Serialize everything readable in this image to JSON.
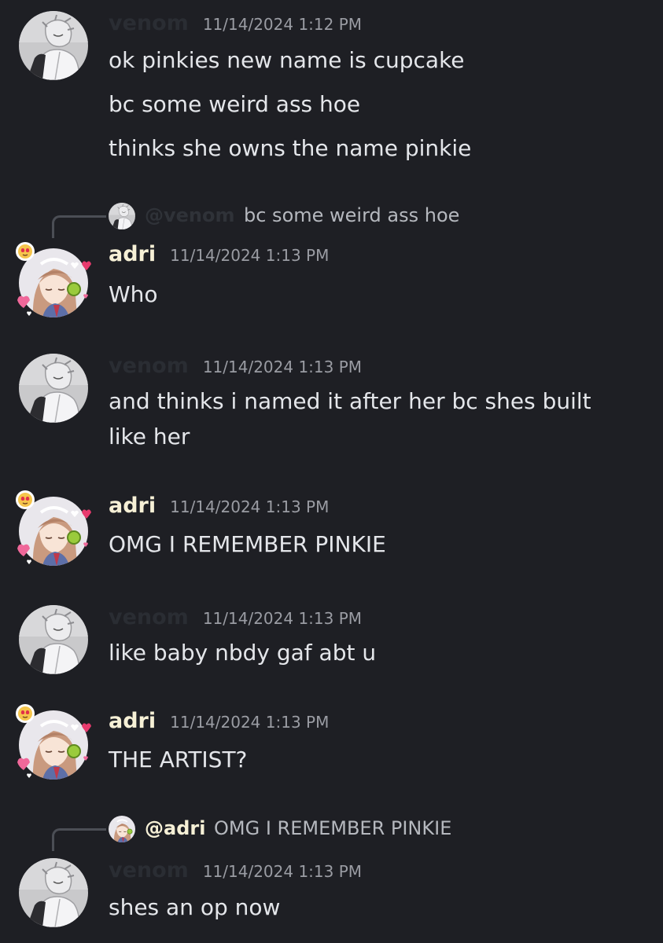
{
  "users": {
    "venom": {
      "name": "venom"
    },
    "adri": {
      "name": "adri"
    }
  },
  "messages": [
    {
      "author": "venom",
      "timestamp": "11/14/2024 1:12 PM",
      "lines": [
        "ok pinkies new name is cupcake",
        "bc some weird ass hoe",
        "thinks she owns the name pinkie"
      ]
    },
    {
      "author": "adri",
      "timestamp": "11/14/2024 1:13 PM",
      "reply": {
        "mention": "@venom",
        "text": "bc some weird ass hoe"
      },
      "lines": [
        "Who"
      ]
    },
    {
      "author": "venom",
      "timestamp": "11/14/2024 1:13 PM",
      "lines": [
        "and thinks i named it after her bc shes built",
        "like her"
      ]
    },
    {
      "author": "adri",
      "timestamp": "11/14/2024 1:13 PM",
      "lines": [
        "OMG I REMEMBER PINKIE"
      ]
    },
    {
      "author": "venom",
      "timestamp": "11/14/2024 1:13 PM",
      "lines": [
        "like baby nbdy gaf abt u"
      ]
    },
    {
      "author": "adri",
      "timestamp": "11/14/2024 1:13 PM",
      "lines": [
        "THE ARTIST?"
      ]
    },
    {
      "author": "venom",
      "timestamp": "11/14/2024 1:13 PM",
      "reply": {
        "mention": "@adri",
        "text": "OMG I REMEMBER PINKIE"
      },
      "lines": [
        "shes an op now"
      ]
    }
  ],
  "icons": {
    "venom_avatar": "avatar-venom-icon",
    "adri_avatar": "avatar-adri-icon",
    "adri_decoration": "heart-decoration-icon"
  },
  "colors": {
    "background": "#1e1f24",
    "venom_name": "#2a2d33",
    "adri_name": "#f6f0d6",
    "timestamp": "#9a9ca3",
    "text": "#e4e6ea",
    "reply_text": "#b5b8be"
  }
}
